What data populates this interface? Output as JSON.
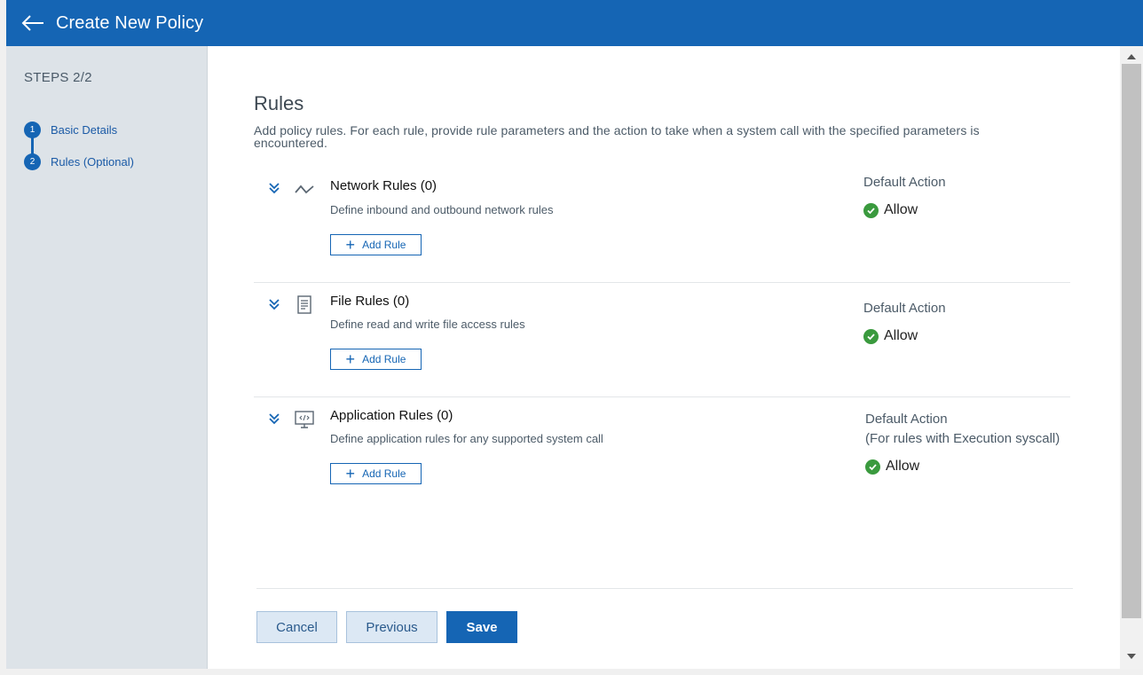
{
  "header": {
    "title": "Create New Policy",
    "back_icon": "arrow-left-icon"
  },
  "sidebar": {
    "steps_label": "STEPS 2/2",
    "steps": [
      {
        "num": "1",
        "label": "Basic Details"
      },
      {
        "num": "2",
        "label": "Rules (Optional)"
      }
    ]
  },
  "main": {
    "title": "Rules",
    "description": "Add policy rules. For each rule, provide rule parameters and the action to take when a system call with the specified parameters is encountered.",
    "rules": [
      {
        "title": "Network Rules (0)",
        "description": "Define inbound and outbound network rules",
        "add_label": "Add Rule",
        "default_action_label": "Default Action",
        "default_action_sub": "",
        "action": "Allow",
        "icon": "network-icon"
      },
      {
        "title": "File Rules (0)",
        "description": "Define read and write file access rules",
        "add_label": "Add Rule",
        "default_action_label": "Default Action",
        "default_action_sub": "",
        "action": "Allow",
        "icon": "file-icon"
      },
      {
        "title": "Application Rules (0)",
        "description": "Define application rules for any supported system call",
        "add_label": "Add Rule",
        "default_action_label": "Default Action",
        "default_action_sub": "(For rules with Execution syscall)",
        "action": "Allow",
        "icon": "application-icon"
      }
    ],
    "buttons": {
      "cancel": "Cancel",
      "previous": "Previous",
      "save": "Save"
    }
  },
  "colors": {
    "brand": "#1565b4",
    "allow": "#3a9a3e",
    "sidebar_bg": "#dde3e8"
  }
}
